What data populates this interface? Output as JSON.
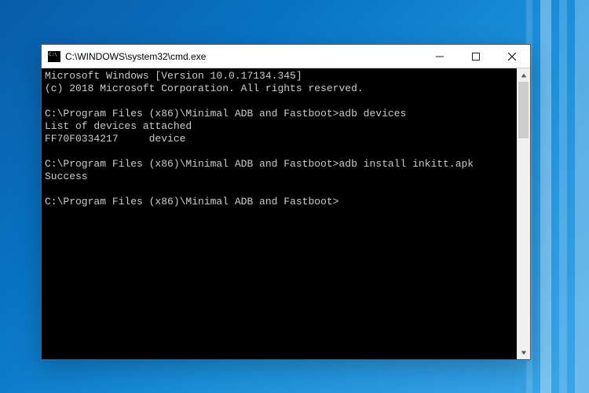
{
  "window": {
    "title": "C:\\WINDOWS\\system32\\cmd.exe"
  },
  "terminal": {
    "header_line1": "Microsoft Windows [Version 10.0.17134.345]",
    "header_line2": "(c) 2018 Microsoft Corporation. All rights reserved.",
    "prompt1": "C:\\Program Files (x86)\\Minimal ADB and Fastboot>",
    "cmd1": "adb devices",
    "out1_line1": "List of devices attached",
    "out1_line2": "FF70F0334217     device",
    "prompt2": "C:\\Program Files (x86)\\Minimal ADB and Fastboot>",
    "cmd2": "adb install inkitt.apk",
    "out2_line1": "Success",
    "prompt3": "C:\\Program Files (x86)\\Minimal ADB and Fastboot>"
  }
}
